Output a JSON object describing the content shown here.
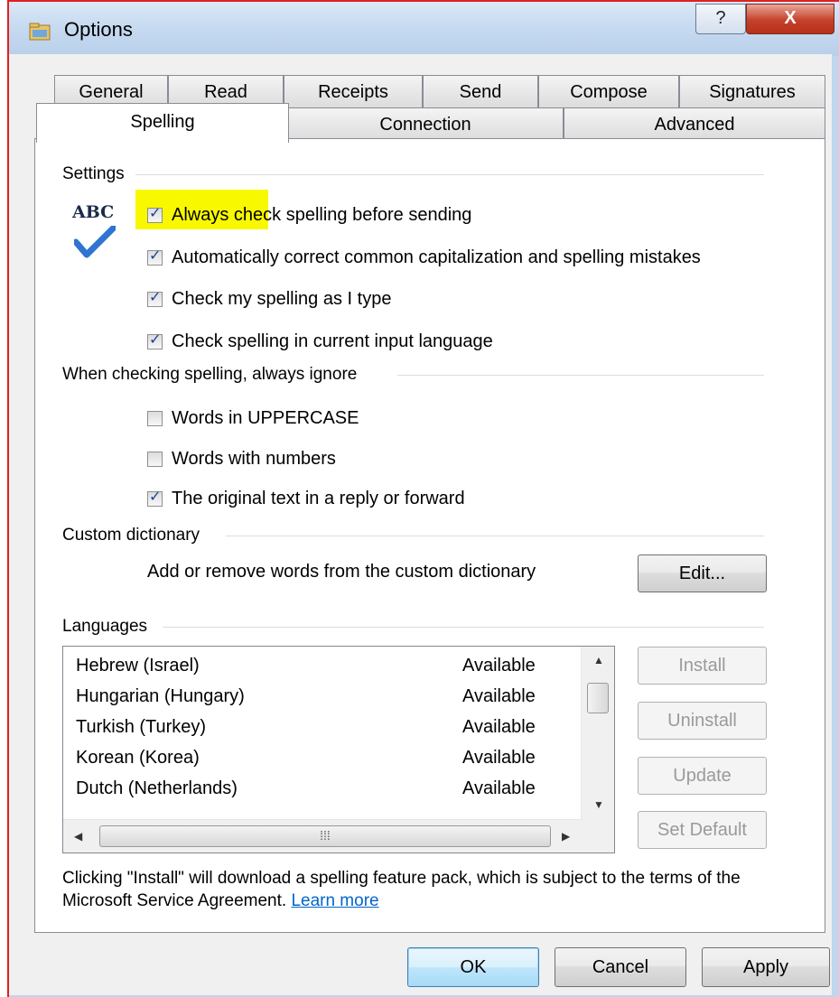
{
  "window": {
    "title": "Options",
    "help_label": "?",
    "close_label": "X"
  },
  "tabs_row1": [
    "General",
    "Read",
    "Receipts",
    "Send",
    "Compose",
    "Signatures"
  ],
  "tabs_row2": [
    "Spelling",
    "Connection",
    "Advanced"
  ],
  "active_tab": "Spelling",
  "settings": {
    "label": "Settings",
    "icon_text": "ABC",
    "options": [
      {
        "label": "Always check spelling before sending",
        "checked": true
      },
      {
        "label": "Automatically correct common capitalization and spelling mistakes",
        "checked": true
      },
      {
        "label": "Check my spelling as I type",
        "checked": true
      },
      {
        "label": "Check spelling in current input language",
        "checked": true
      }
    ]
  },
  "ignore": {
    "label": "When checking spelling, always ignore",
    "options": [
      {
        "label": "Words in UPPERCASE",
        "checked": false
      },
      {
        "label": "Words with numbers",
        "checked": false
      },
      {
        "label": "The original text in a reply or forward",
        "checked": true
      }
    ]
  },
  "custom_dictionary": {
    "label": "Custom dictionary",
    "description": "Add or remove words from the custom dictionary",
    "edit_button": "Edit..."
  },
  "languages": {
    "label": "Languages",
    "rows": [
      {
        "name": "Hebrew (Israel)",
        "status": "Available"
      },
      {
        "name": "Hungarian (Hungary)",
        "status": "Available"
      },
      {
        "name": "Turkish (Turkey)",
        "status": "Available"
      },
      {
        "name": "Korean (Korea)",
        "status": "Available"
      },
      {
        "name": "Dutch (Netherlands)",
        "status": "Available"
      }
    ],
    "buttons": [
      "Install",
      "Uninstall",
      "Update",
      "Set Default"
    ]
  },
  "footer": {
    "text": "Clicking \"Install\" will download a spelling feature pack, which is subject to the terms of the Microsoft Service Agreement.",
    "link": "Learn more"
  },
  "dialog_buttons": {
    "ok": "OK",
    "cancel": "Cancel",
    "apply": "Apply"
  },
  "colors": {
    "highlight": "#f8f800",
    "checkmark": "#1b3f9a",
    "link": "#0066cc"
  }
}
